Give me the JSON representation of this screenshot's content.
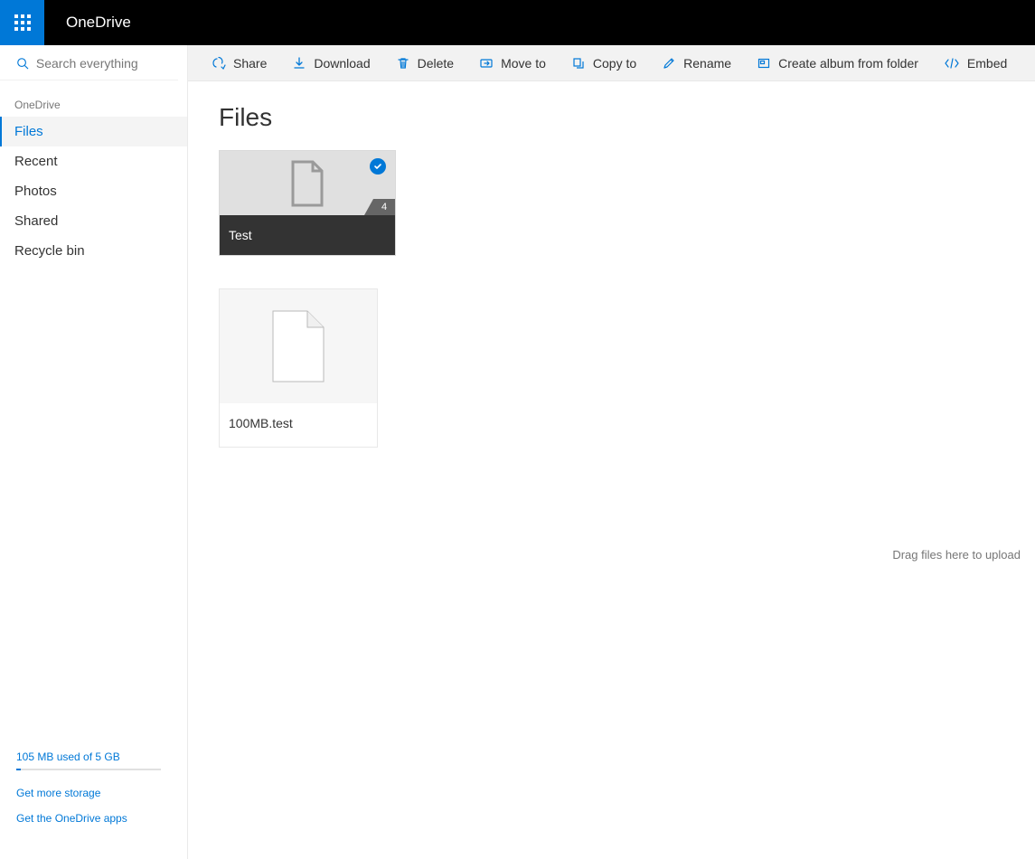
{
  "header": {
    "brand": "OneDrive"
  },
  "search": {
    "placeholder": "Search everything"
  },
  "crumb": "OneDrive",
  "nav": [
    {
      "label": "Files",
      "active": true
    },
    {
      "label": "Recent",
      "active": false
    },
    {
      "label": "Photos",
      "active": false
    },
    {
      "label": "Shared",
      "active": false
    },
    {
      "label": "Recycle bin",
      "active": false
    }
  ],
  "storage": {
    "text": "105 MB used of 5 GB",
    "get_more": "Get more storage",
    "get_apps": "Get the OneDrive apps"
  },
  "commands": [
    {
      "id": "share",
      "label": "Share",
      "icon": "share"
    },
    {
      "id": "download",
      "label": "Download",
      "icon": "download"
    },
    {
      "id": "delete",
      "label": "Delete",
      "icon": "delete"
    },
    {
      "id": "move",
      "label": "Move to",
      "icon": "move"
    },
    {
      "id": "copy",
      "label": "Copy to",
      "icon": "copy"
    },
    {
      "id": "rename",
      "label": "Rename",
      "icon": "rename"
    },
    {
      "id": "album",
      "label": "Create album from folder",
      "icon": "album"
    },
    {
      "id": "embed",
      "label": "Embed",
      "icon": "embed"
    }
  ],
  "page": {
    "title": "Files",
    "drop_hint": "Drag files here to upload"
  },
  "items": {
    "folder": {
      "name": "Test",
      "count": "4",
      "selected": true
    },
    "file": {
      "name": "100MB.test"
    }
  },
  "colors": {
    "accent": "#0078d7"
  }
}
